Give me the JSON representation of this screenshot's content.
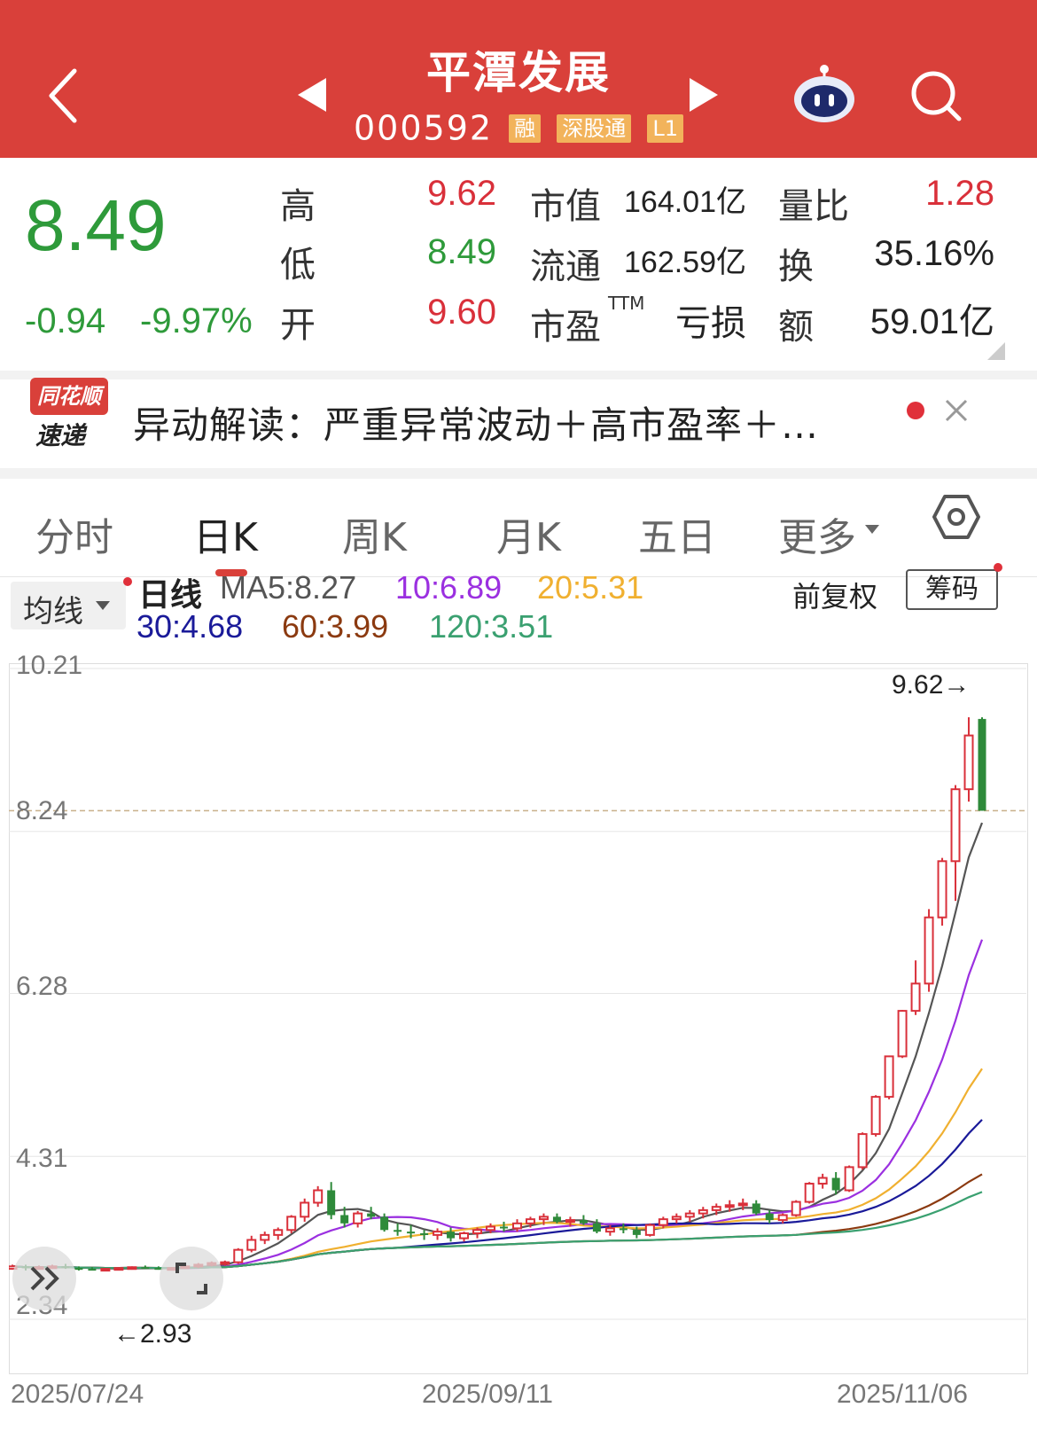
{
  "header": {
    "title": "平潭发展",
    "code": "000592",
    "tags": [
      "融",
      "深股通",
      "L1"
    ],
    "colors": {
      "background": "#d9403a",
      "tag": "#f2b35b"
    }
  },
  "quote": {
    "price": "8.49",
    "change": "-0.94",
    "change_pct": "-9.97%",
    "high_label": "高",
    "high": "9.62",
    "low_label": "低",
    "low": "8.49",
    "open_label": "开",
    "open": "9.60",
    "mcap_label": "市值",
    "mcap": "164.01亿",
    "float_label": "流通",
    "float": "162.59亿",
    "pe_label": "市盈",
    "pe_sup": "TTM",
    "pe": "亏损",
    "vol_ratio_label": "量比",
    "vol_ratio": "1.28",
    "turnover_label": "换",
    "turnover": "35.16%",
    "amount_label": "额",
    "amount": "59.01亿"
  },
  "news": {
    "logo_top": "同花顺",
    "logo_bottom": "速递",
    "text": "异动解读：严重异常波动＋高市盈率＋…"
  },
  "tabs": [
    {
      "label": "分时"
    },
    {
      "label": "日K"
    },
    {
      "label": "周K"
    },
    {
      "label": "月K"
    },
    {
      "label": "五日"
    },
    {
      "label": "更多"
    }
  ],
  "indicators": {
    "selector": "均线",
    "line_label": "日线",
    "ma5": "MA5:8.27",
    "ma10": "10:6.89",
    "ma20": "20:5.31",
    "ma30": "30:4.68",
    "ma60": "60:3.99",
    "ma120": "120:3.51",
    "adjust": "前复权",
    "chips": "筹码",
    "colors": {
      "ma5": "#555555",
      "ma10": "#9b30e0",
      "ma20": "#f0b030",
      "ma30": "#1a1a99",
      "ma60": "#8b3a10",
      "ma120": "#3aa070"
    }
  },
  "chart_data": {
    "type": "candlestick",
    "y_ticks": [
      "10.21",
      "8.24",
      "6.28",
      "4.31",
      "2.34"
    ],
    "ylim": [
      2.34,
      10.21
    ],
    "x_ticks": [
      "2025/07/24",
      "2025/09/11",
      "2025/11/06"
    ],
    "max_annotation": "9.62→",
    "min_annotation": "←2.93",
    "last_close_line": 8.49,
    "candles": [
      [
        2.95,
        3.0,
        2.94,
        2.98
      ],
      [
        2.98,
        3.0,
        2.93,
        2.96
      ],
      [
        2.96,
        2.99,
        2.94,
        2.97
      ],
      [
        2.97,
        3.0,
        2.95,
        2.98
      ],
      [
        2.98,
        3.01,
        2.95,
        2.96
      ],
      [
        2.96,
        2.98,
        2.93,
        2.95
      ],
      [
        2.95,
        2.97,
        2.93,
        2.94
      ],
      [
        2.94,
        2.96,
        2.92,
        2.95
      ],
      [
        2.95,
        2.97,
        2.93,
        2.96
      ],
      [
        2.96,
        2.98,
        2.94,
        2.97
      ],
      [
        2.97,
        2.99,
        2.95,
        2.96
      ],
      [
        2.96,
        2.98,
        2.94,
        2.95
      ],
      [
        2.95,
        2.97,
        2.93,
        2.96
      ],
      [
        2.96,
        2.99,
        2.95,
        2.98
      ],
      [
        2.98,
        3.02,
        2.96,
        3.0
      ],
      [
        3.0,
        3.04,
        2.98,
        3.02
      ],
      [
        3.02,
        3.05,
        2.99,
        3.03
      ],
      [
        3.03,
        3.2,
        3.01,
        3.18
      ],
      [
        3.18,
        3.35,
        3.15,
        3.3
      ],
      [
        3.3,
        3.4,
        3.25,
        3.36
      ],
      [
        3.36,
        3.45,
        3.3,
        3.42
      ],
      [
        3.42,
        3.6,
        3.38,
        3.58
      ],
      [
        3.58,
        3.8,
        3.52,
        3.75
      ],
      [
        3.75,
        3.95,
        3.7,
        3.9
      ],
      [
        3.9,
        4.0,
        3.55,
        3.6
      ],
      [
        3.6,
        3.7,
        3.45,
        3.5
      ],
      [
        3.5,
        3.65,
        3.45,
        3.62
      ],
      [
        3.62,
        3.7,
        3.55,
        3.58
      ],
      [
        3.58,
        3.62,
        3.4,
        3.42
      ],
      [
        3.42,
        3.5,
        3.35,
        3.4
      ],
      [
        3.4,
        3.48,
        3.32,
        3.38
      ],
      [
        3.38,
        3.42,
        3.3,
        3.36
      ],
      [
        3.36,
        3.44,
        3.3,
        3.4
      ],
      [
        3.4,
        3.45,
        3.28,
        3.32
      ],
      [
        3.32,
        3.4,
        3.28,
        3.38
      ],
      [
        3.38,
        3.45,
        3.32,
        3.42
      ],
      [
        3.42,
        3.5,
        3.38,
        3.46
      ],
      [
        3.46,
        3.52,
        3.4,
        3.44
      ],
      [
        3.44,
        3.55,
        3.4,
        3.5
      ],
      [
        3.5,
        3.58,
        3.45,
        3.55
      ],
      [
        3.55,
        3.62,
        3.48,
        3.58
      ],
      [
        3.58,
        3.62,
        3.5,
        3.52
      ],
      [
        3.52,
        3.58,
        3.46,
        3.54
      ],
      [
        3.54,
        3.6,
        3.48,
        3.5
      ],
      [
        3.5,
        3.55,
        3.38,
        3.4
      ],
      [
        3.4,
        3.48,
        3.35,
        3.44
      ],
      [
        3.44,
        3.5,
        3.38,
        3.42
      ],
      [
        3.42,
        3.46,
        3.32,
        3.36
      ],
      [
        3.36,
        3.5,
        3.34,
        3.48
      ],
      [
        3.48,
        3.58,
        3.44,
        3.55
      ],
      [
        3.55,
        3.62,
        3.5,
        3.58
      ],
      [
        3.58,
        3.66,
        3.52,
        3.62
      ],
      [
        3.62,
        3.7,
        3.56,
        3.66
      ],
      [
        3.66,
        3.74,
        3.6,
        3.7
      ],
      [
        3.7,
        3.78,
        3.64,
        3.72
      ],
      [
        3.72,
        3.8,
        3.66,
        3.74
      ],
      [
        3.74,
        3.78,
        3.6,
        3.62
      ],
      [
        3.62,
        3.66,
        3.5,
        3.54
      ],
      [
        3.54,
        3.62,
        3.5,
        3.6
      ],
      [
        3.6,
        3.78,
        3.58,
        3.76
      ],
      [
        3.76,
        4.0,
        3.74,
        3.98
      ],
      [
        3.98,
        4.1,
        3.92,
        4.05
      ],
      [
        4.05,
        4.12,
        3.85,
        3.9
      ],
      [
        3.9,
        4.2,
        3.88,
        4.18
      ],
      [
        4.18,
        4.6,
        4.15,
        4.58
      ],
      [
        4.58,
        5.05,
        4.55,
        5.03
      ],
      [
        5.03,
        5.53,
        5.0,
        5.52
      ],
      [
        5.52,
        6.08,
        5.5,
        6.07
      ],
      [
        6.07,
        6.68,
        6.02,
        6.4
      ],
      [
        6.4,
        7.3,
        6.3,
        7.2
      ],
      [
        7.2,
        7.92,
        7.1,
        7.88
      ],
      [
        7.88,
        8.8,
        7.4,
        8.75
      ],
      [
        8.75,
        9.62,
        8.6,
        9.4
      ],
      [
        9.6,
        9.62,
        8.49,
        8.49
      ]
    ]
  }
}
